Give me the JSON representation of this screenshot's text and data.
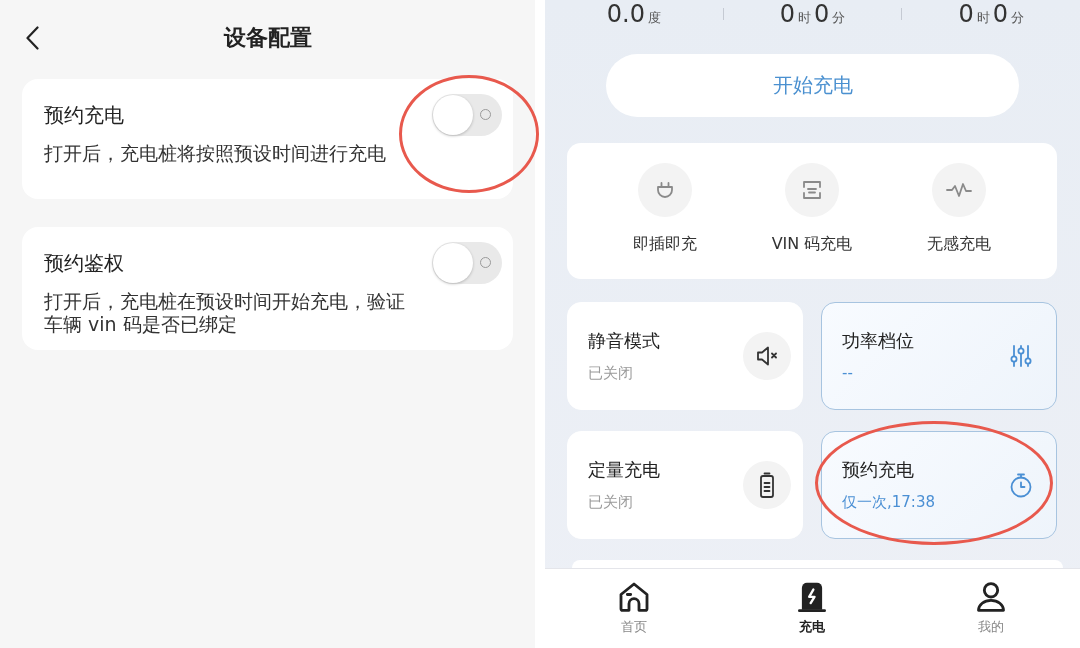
{
  "settings_screen": {
    "title": "设备配置",
    "items": [
      {
        "title": "预约充电",
        "description": "打开后，充电桩将按照预设时间进行充电",
        "on": false,
        "highlighted": true
      },
      {
        "title": "预约鉴权",
        "description": "打开后，充电桩在预设时间开始充电，验证车辆 vin 码是否已绑定",
        "on": false,
        "highlighted": false
      }
    ]
  },
  "charging_screen": {
    "stats": [
      [
        {
          "kind": "number",
          "text": "0.0"
        },
        {
          "kind": "unit",
          "text": "度"
        }
      ],
      [
        {
          "kind": "number",
          "text": "0"
        },
        {
          "kind": "unit",
          "text": "时"
        },
        {
          "kind": "number",
          "text": "0"
        },
        {
          "kind": "unit",
          "text": "分"
        }
      ],
      [
        {
          "kind": "number",
          "text": "0"
        },
        {
          "kind": "unit",
          "text": "时"
        },
        {
          "kind": "number",
          "text": "0"
        },
        {
          "kind": "unit",
          "text": "分"
        }
      ]
    ],
    "start_button": "开始充电",
    "quick_actions": [
      {
        "label": "即插即充"
      },
      {
        "label": "VIN 码充电"
      },
      {
        "label": "无感充电"
      }
    ],
    "features": [
      {
        "title": "静音模式",
        "status": "已关闭",
        "active": false,
        "highlighted": false
      },
      {
        "title": "功率档位",
        "status": "--",
        "active": true,
        "highlighted": false
      },
      {
        "title": "定量充电",
        "status": "已关闭",
        "active": false,
        "highlighted": false
      },
      {
        "title": "预约充电",
        "status": "仅一次,17:38",
        "active": true,
        "highlighted": true
      }
    ],
    "tabs": [
      {
        "label": "首页",
        "selected": false
      },
      {
        "label": "充电",
        "selected": true
      },
      {
        "label": "我的",
        "selected": false
      }
    ]
  }
}
